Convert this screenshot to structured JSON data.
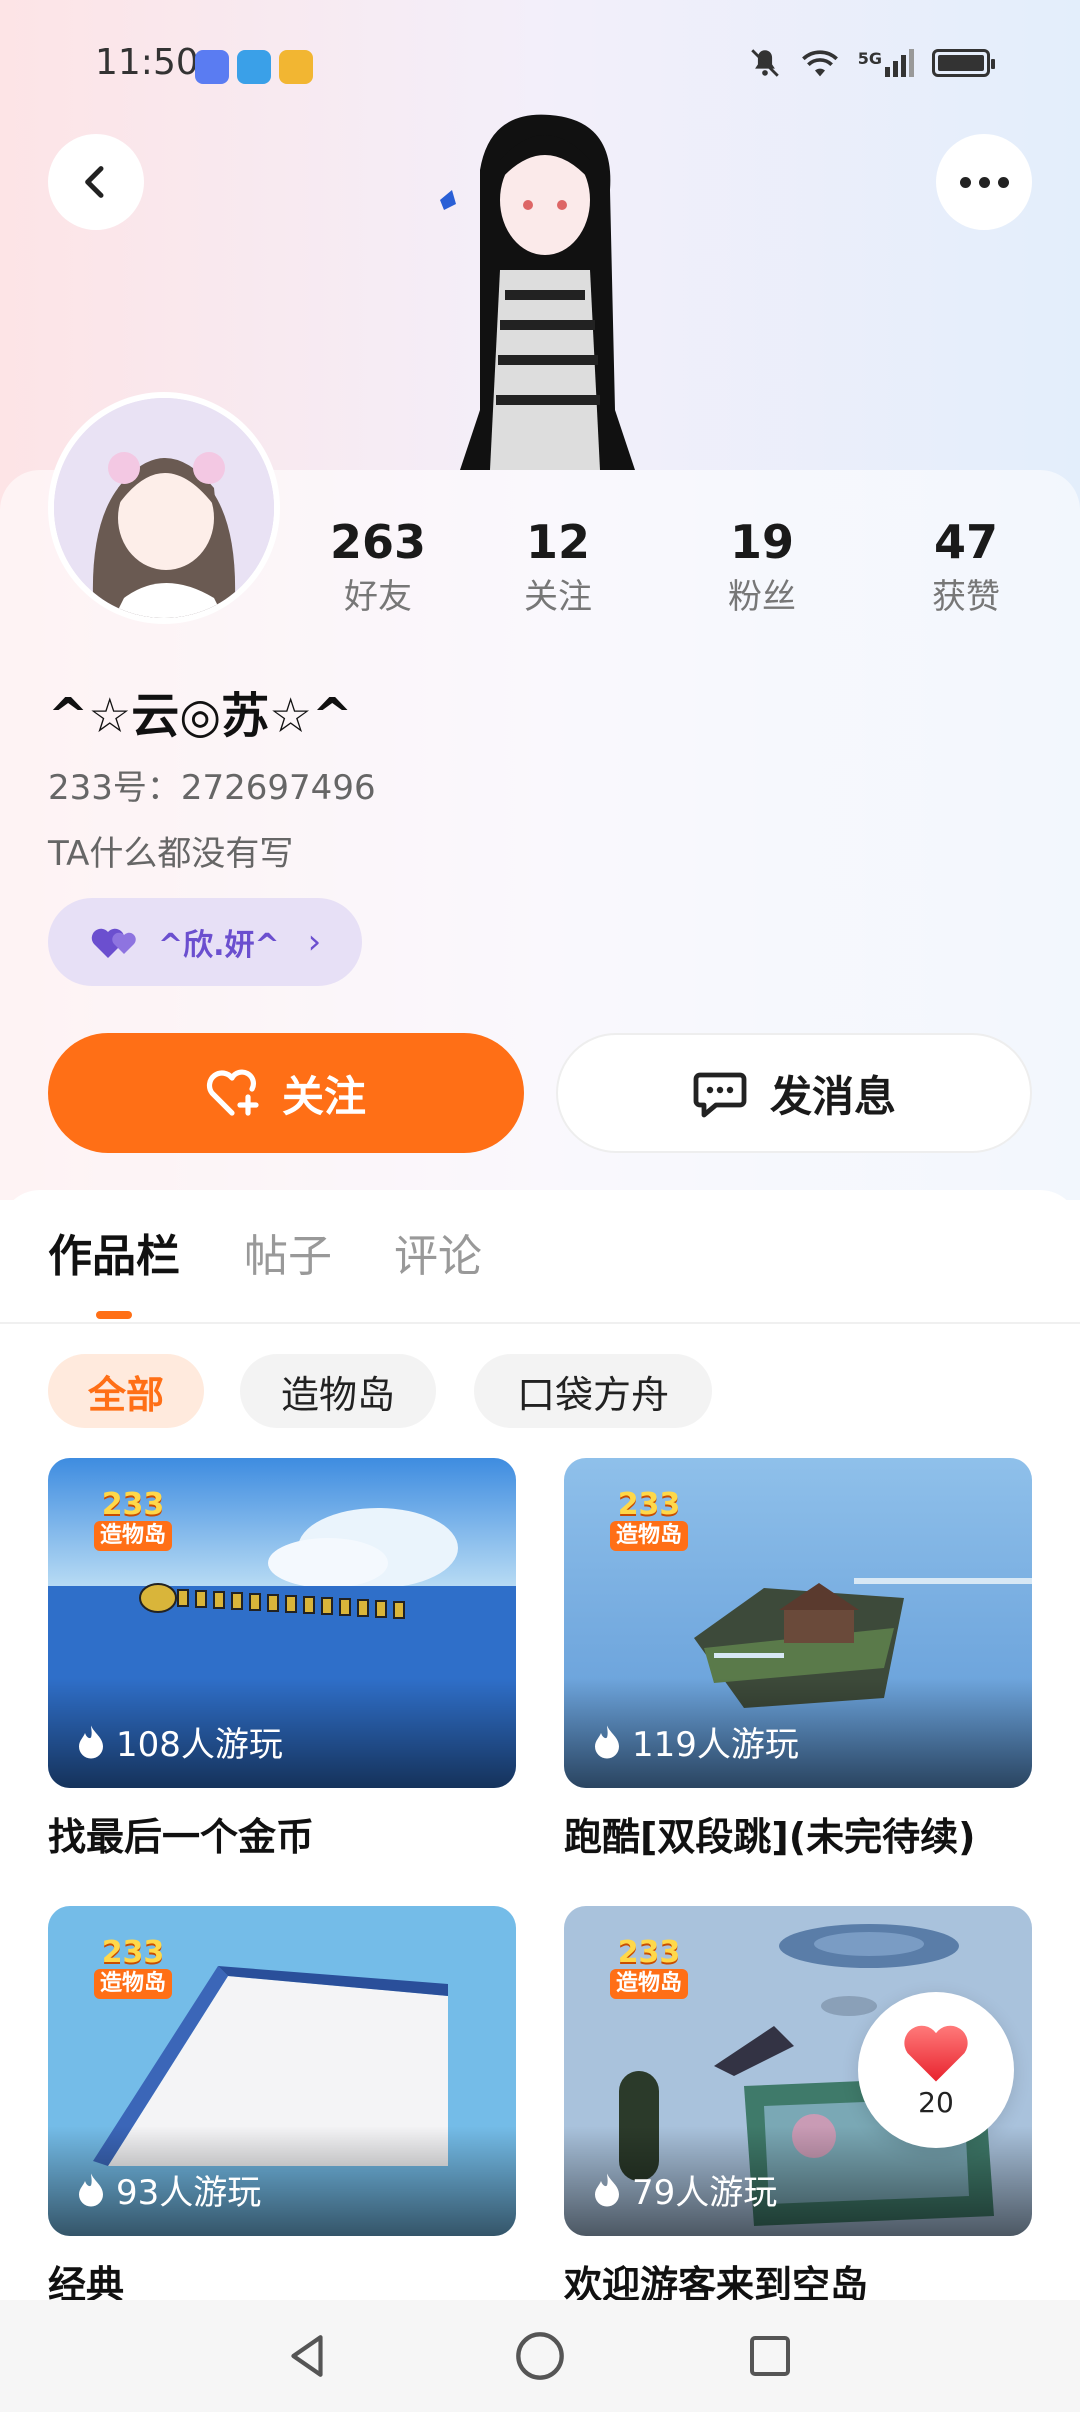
{
  "status_bar": {
    "time": "11:50",
    "network": "5G"
  },
  "profile": {
    "username": "^☆云◎苏☆^",
    "id_label": "233号：272697496",
    "bio": "TA什么都没有写",
    "relation_tag": "^欣.妍^",
    "stats": [
      {
        "value": "263",
        "label": "好友"
      },
      {
        "value": "12",
        "label": "关注"
      },
      {
        "value": "19",
        "label": "粉丝"
      },
      {
        "value": "47",
        "label": "获赞"
      }
    ]
  },
  "actions": {
    "follow_label": "关注",
    "message_label": "发消息"
  },
  "tabs": [
    {
      "label": "作品栏",
      "active": true
    },
    {
      "label": "帖子",
      "active": false
    },
    {
      "label": "评论",
      "active": false
    }
  ],
  "filters": [
    {
      "label": "全部",
      "active": true
    },
    {
      "label": "造物岛",
      "active": false
    },
    {
      "label": "口袋方舟",
      "active": false
    }
  ],
  "badge": {
    "number": "233",
    "text": "造物岛"
  },
  "works": [
    {
      "title": "找最后一个金币",
      "plays": "108人游玩"
    },
    {
      "title": "跑酷[双段跳](未完待续)",
      "plays": "119人游玩"
    },
    {
      "title": "经典",
      "plays": "93人游玩"
    },
    {
      "title": "欢迎游客来到空岛",
      "plays": "79人游玩"
    }
  ],
  "like_button": {
    "count": "20"
  },
  "colors": {
    "accent": "#ff6f16",
    "relation": "#6b4fcf"
  },
  "icons": {
    "back": "chevron-left-icon",
    "more": "more-dots-icon",
    "follow": "heart-plus-icon",
    "message": "chat-bubble-icon",
    "plays": "flame-icon",
    "like": "heart-icon"
  }
}
